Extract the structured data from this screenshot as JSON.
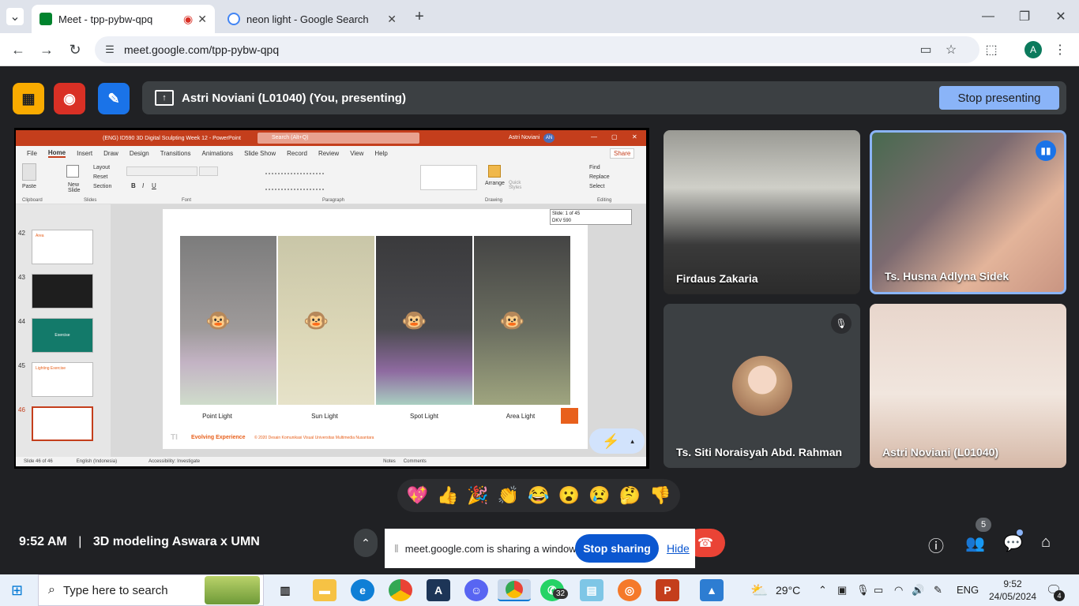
{
  "browser": {
    "tabs": [
      {
        "title": "Meet - tpp-pybw-qpq",
        "active": true
      },
      {
        "title": "neon light - Google Search",
        "active": false
      }
    ],
    "url": "meet.google.com/tpp-pybw-qpq",
    "profile_initial": "A"
  },
  "meet": {
    "presenting_banner": "Astri Noviani (L01040) (You, presenting)",
    "stop_presenting_label": "Stop presenting",
    "participants": [
      {
        "name": "Firdaus Zakaria"
      },
      {
        "name": "Ts. Husna Adlyna Sidek"
      },
      {
        "name": "Ts. Siti Noraisyah Abd. Rahman"
      },
      {
        "name": "Astri Noviani (L01040)"
      }
    ],
    "reactions": [
      "💖",
      "👍",
      "🎉",
      "👏",
      "😂",
      "😮",
      "😢",
      "🤔",
      "👎"
    ],
    "time": "9:52 AM",
    "meeting_title": "3D modeling Aswara x UMN",
    "people_count": "5",
    "share_notice": "meet.google.com is sharing a window.",
    "stop_sharing_label": "Stop sharing",
    "hide_label": "Hide"
  },
  "powerpoint": {
    "window_title": "(ENG) ID590 3D Digital Sculpting Week 12  -  PowerPoint",
    "search_placeholder": "Search (Alt+Q)",
    "user": "Astri Noviani",
    "user_initials": "AN",
    "menu_tabs": [
      "File",
      "Home",
      "Insert",
      "Draw",
      "Design",
      "Transitions",
      "Animations",
      "Slide Show",
      "Record",
      "Review",
      "View",
      "Help"
    ],
    "share_label": "Share",
    "groups": [
      "Clipboard",
      "Slides",
      "Font",
      "Paragraph",
      "Drawing",
      "Editing"
    ],
    "ribbon_buttons": {
      "paste": "Paste",
      "new_slide": "New Slide",
      "layout": "Layout",
      "reset": "Reset",
      "section": "Section",
      "arrange": "Arrange",
      "quick_styles": "Quick Styles",
      "find": "Find",
      "replace": "Replace",
      "select": "Select"
    },
    "thumbnails": [
      {
        "num": "42",
        "title": "Area"
      },
      {
        "num": "43",
        "title": ""
      },
      {
        "num": "44",
        "title": "Exercise"
      },
      {
        "num": "45",
        "title": "Lighting Exercise"
      },
      {
        "num": "46",
        "title": ""
      }
    ],
    "slide_tooltip": [
      "Slide: 1 of 45",
      "DKV 590"
    ],
    "captions": [
      "Point Light",
      "Sun Light",
      "Spot Light",
      "Area Light"
    ],
    "footer_brand": "Evolving Experience",
    "footer_copy": "© 2020 Desain Komunikasi Visual Universitas Multimedia Nusantara",
    "status": {
      "slide": "Slide 46 of 46",
      "language": "English (Indonesia)",
      "accessibility": "Accessibility: Investigate",
      "notes": "Notes",
      "comments": "Comments"
    }
  },
  "taskbar": {
    "search_placeholder": "Type here to search",
    "whatsapp_badge": "32",
    "temperature": "29°C",
    "language": "ENG",
    "time": "9:52",
    "date": "24/05/2024",
    "notifications": "4"
  }
}
